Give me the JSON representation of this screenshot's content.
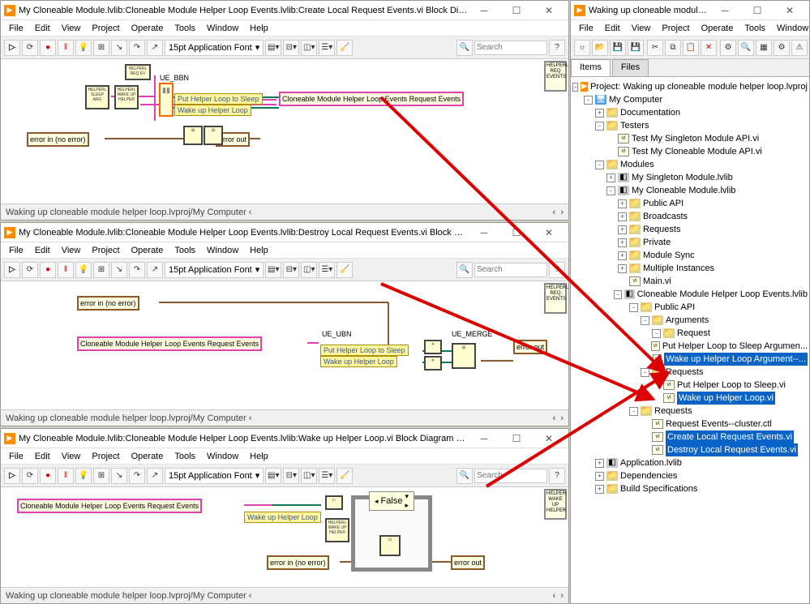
{
  "menus": {
    "file": "File",
    "edit": "Edit",
    "view": "View",
    "project": "Project",
    "operate": "Operate",
    "tools": "Tools",
    "window": "Window",
    "help": "Help"
  },
  "toolbar": {
    "font": "15pt Application Font",
    "search_ph": "Search"
  },
  "labels": {
    "put_sleep": "Put Helper Loop to Sleep",
    "wake": "Wake up Helper Loop",
    "ue_bbn": "UE_BBN",
    "ue_ubn": "UE_UBN",
    "ue_merge": "UE_MERGE",
    "err_in": "error in (no error)",
    "err_out": "error out",
    "req_events": "Cloneable Module Helper Loop Events Request Events",
    "false": "False"
  },
  "win1": {
    "title": "My Cloneable Module.lvlib:Cloneable Module Helper Loop Events.lvlib:Create Local Request Events.vi Block Diagram on Waking up cl..."
  },
  "win2": {
    "title": "My Cloneable Module.lvlib:Cloneable Module Helper Loop Events.lvlib:Destroy Local Request Events.vi Block Diagram on Waking ...."
  },
  "win3": {
    "title": "My Cloneable Module.lvlib:Cloneable Module Helper Loop Events.lvlib:Wake up Helper Loop.vi Block Diagram on Waking up cloneab..."
  },
  "win4": {
    "title": "Waking up cloneable module helper..."
  },
  "status": "Waking up cloneable module helper loop.lvproj/My Computer",
  "proj_tabs": {
    "items": "Items",
    "files": "Files"
  },
  "tree": [
    {
      "d": 0,
      "t": "-",
      "i": "proj",
      "l": "Project: Waking up cloneable module helper loop.lvproj"
    },
    {
      "d": 1,
      "t": "-",
      "i": "comp",
      "l": "My Computer"
    },
    {
      "d": 2,
      "t": "+",
      "i": "fold",
      "l": "Documentation"
    },
    {
      "d": 2,
      "t": "-",
      "i": "fold",
      "l": "Testers"
    },
    {
      "d": 3,
      "t": " ",
      "i": "vi",
      "l": "Test My Singleton Module API.vi"
    },
    {
      "d": 3,
      "t": " ",
      "i": "vi",
      "l": "Test My Cloneable Module API.vi"
    },
    {
      "d": 2,
      "t": "-",
      "i": "fold",
      "l": "Modules"
    },
    {
      "d": 3,
      "t": "+",
      "i": "lib",
      "l": "My Singleton Module.lvlib"
    },
    {
      "d": 3,
      "t": "-",
      "i": "lib",
      "l": "My Cloneable Module.lvlib"
    },
    {
      "d": 4,
      "t": "+",
      "i": "fold",
      "l": "Public API"
    },
    {
      "d": 4,
      "t": "+",
      "i": "fold",
      "l": "Broadcasts"
    },
    {
      "d": 4,
      "t": "+",
      "i": "fold",
      "l": "Requests"
    },
    {
      "d": 4,
      "t": "+",
      "i": "fold",
      "l": "Private"
    },
    {
      "d": 4,
      "t": "+",
      "i": "fold",
      "l": "Module Sync"
    },
    {
      "d": 4,
      "t": "+",
      "i": "fold",
      "l": "Multiple Instances"
    },
    {
      "d": 4,
      "t": " ",
      "i": "vi",
      "l": "Main.vi"
    },
    {
      "d": 4,
      "t": "-",
      "i": "lib",
      "l": "Cloneable Module Helper Loop Events.lvlib"
    },
    {
      "d": 5,
      "t": "-",
      "i": "fold",
      "l": "Public API"
    },
    {
      "d": 6,
      "t": "-",
      "i": "fold",
      "l": "Arguments"
    },
    {
      "d": 7,
      "t": "-",
      "i": "fold",
      "l": "Request"
    },
    {
      "d": 8,
      "t": " ",
      "i": "vi",
      "l": "Put Helper Loop to Sleep Argumen..."
    },
    {
      "d": 8,
      "t": " ",
      "i": "vi",
      "l": "Wake up Helper Loop Argument--...",
      "sel": true
    },
    {
      "d": 6,
      "t": "-",
      "i": "fold",
      "l": "Requests"
    },
    {
      "d": 7,
      "t": " ",
      "i": "vi",
      "l": "Put Helper Loop to Sleep.vi"
    },
    {
      "d": 7,
      "t": " ",
      "i": "vi",
      "l": "Wake up Helper Loop.vi",
      "sel": true
    },
    {
      "d": 5,
      "t": "-",
      "i": "fold",
      "l": "Requests"
    },
    {
      "d": 6,
      "t": " ",
      "i": "vi",
      "l": "Request Events--cluster.ctl"
    },
    {
      "d": 6,
      "t": " ",
      "i": "vi",
      "l": "Create Local Request Events.vi",
      "sel": true
    },
    {
      "d": 6,
      "t": " ",
      "i": "vi",
      "l": "Destroy Local Request Events.vi",
      "sel": true
    },
    {
      "d": 2,
      "t": "+",
      "i": "lib",
      "l": "Application.lvlib"
    },
    {
      "d": 2,
      "t": "+",
      "i": "fold",
      "l": "Dependencies"
    },
    {
      "d": 2,
      "t": "+",
      "i": "fold",
      "l": "Build Specifications"
    }
  ]
}
